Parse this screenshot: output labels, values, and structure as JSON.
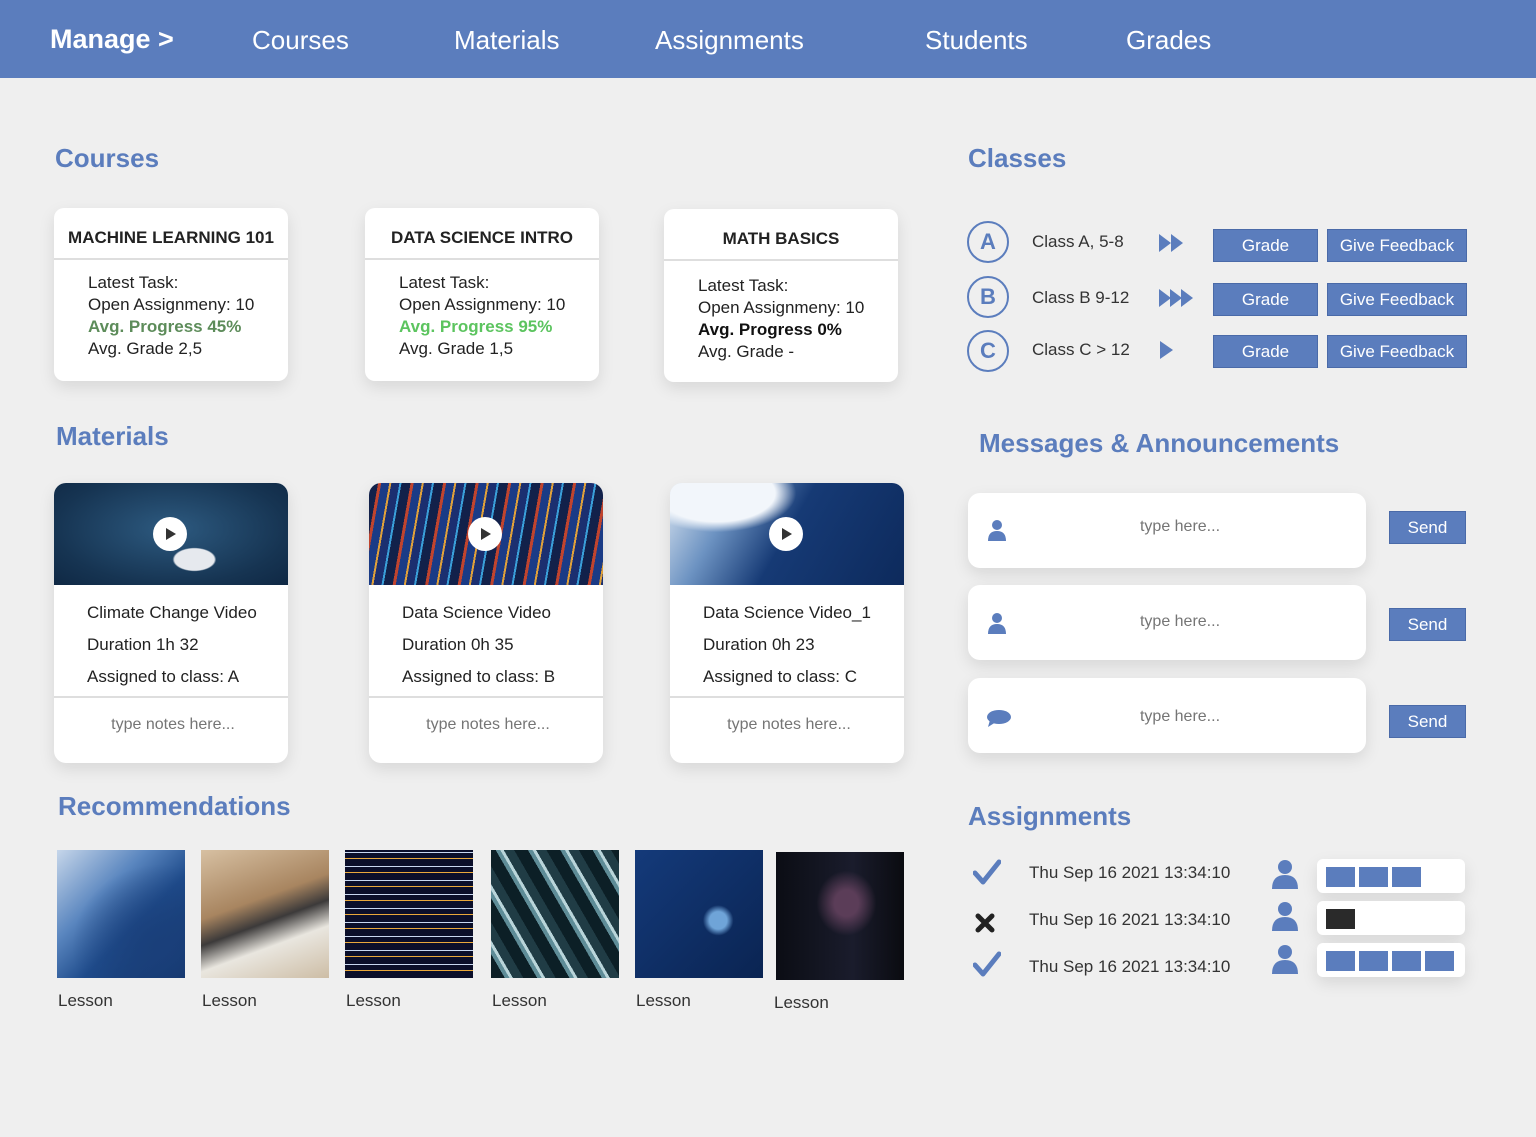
{
  "nav": {
    "brand": "Manage >",
    "links": [
      "Courses",
      "Materials",
      "Assignments",
      "Students",
      "Grades"
    ]
  },
  "headings": {
    "courses": "Courses",
    "materials": "Materials",
    "recommendations": "Recommendations",
    "classes": "Classes",
    "messages": "Messages & Announcements",
    "assignments": "Assignments"
  },
  "courses": [
    {
      "title": "MACHINE LEARNING 101",
      "task": "Latest Task:",
      "open": "Open Assignmeny: 10",
      "progress": "Avg. Progress 45%",
      "grade": "Avg. Grade 2,5"
    },
    {
      "title": "DATA SCIENCE INTRO",
      "task": "Latest Task:",
      "open": "Open Assignmeny: 10",
      "progress": "Avg. Progress 95%",
      "grade": "Avg. Grade 1,5"
    },
    {
      "title": "MATH BASICS",
      "task": "Latest Task:",
      "open": "Open Assignmeny: 10",
      "progress": "Avg. Progress 0%",
      "grade": "Avg. Grade -"
    }
  ],
  "materials": [
    {
      "title": "Climate Change Video",
      "duration": "Duration 1h 32",
      "assigned": "Assigned to class: A",
      "notes_placeholder": "type notes here..."
    },
    {
      "title": "Data Science Video",
      "duration": "Duration 0h 35",
      "assigned": "Assigned to class: B",
      "notes_placeholder": "type notes here..."
    },
    {
      "title": "Data Science Video_1",
      "duration": "Duration 0h 23",
      "assigned": "Assigned to class: C",
      "notes_placeholder": "type notes here..."
    }
  ],
  "recommendations": [
    {
      "label": "Lesson"
    },
    {
      "label": "Lesson"
    },
    {
      "label": "Lesson"
    },
    {
      "label": "Lesson"
    },
    {
      "label": "Lesson"
    },
    {
      "label": "Lesson"
    }
  ],
  "classes": [
    {
      "badge": "A",
      "name": "Class A, 5-8",
      "grade_label": "Grade",
      "feedback_label": "Give Feedback",
      "arrow_icon": "double-arrow-icon"
    },
    {
      "badge": "B",
      "name": "Class  B  9-12",
      "grade_label": "Grade",
      "feedback_label": "Give Feedback",
      "arrow_icon": "triple-arrow-icon"
    },
    {
      "badge": "C",
      "name": "Class  C > 12",
      "grade_label": "Grade",
      "feedback_label": "Give Feedback",
      "arrow_icon": "single-arrow-icon"
    }
  ],
  "messages": [
    {
      "icon": "user-icon",
      "placeholder": "type here...",
      "send_label": "Send"
    },
    {
      "icon": "user-icon",
      "placeholder": "type here...",
      "send_label": "Send"
    },
    {
      "icon": "chat-bubble-icon",
      "placeholder": "type here...",
      "send_label": "Send"
    }
  ],
  "assignments": [
    {
      "status": "check-icon",
      "time": "Thu Sep 16 2021 13:34:10",
      "progress_segments": 3,
      "segment_color": "#5b7dbd"
    },
    {
      "status": "cross-icon",
      "time": "Thu Sep 16 2021 13:34:10",
      "progress_segments": 1,
      "segment_color": "#2a2a2a"
    },
    {
      "status": "check-icon",
      "time": "Thu Sep 16 2021 13:34:10",
      "progress_segments": 4,
      "segment_color": "#5b7dbd"
    }
  ],
  "colors": {
    "accent": "#5b7dbd",
    "background": "#efefef",
    "progress_mid": "#5d8c5a",
    "progress_high": "#5cc45f"
  }
}
